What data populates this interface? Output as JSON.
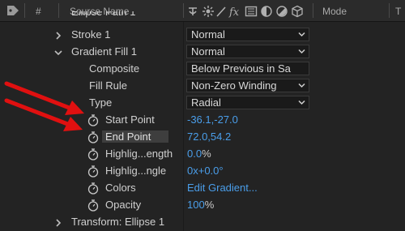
{
  "header": {
    "hash": "#",
    "source_name": "Source Name",
    "mode": "Mode",
    "t": "T"
  },
  "rows": {
    "ellipse_path": "Ellipse Path 1",
    "stroke": "Stroke 1",
    "stroke_value": "Normal",
    "gradient_fill": "Gradient Fill 1",
    "gradient_fill_value": "Normal",
    "composite": "Composite",
    "composite_value": "Below Previous in Sa",
    "fill_rule": "Fill Rule",
    "fill_rule_value": "Non-Zero Winding",
    "type": "Type",
    "type_value": "Radial",
    "start_point": "Start Point",
    "start_point_value": "-36.1,-27.0",
    "end_point": "End Point",
    "end_point_value": "72.0,54.2",
    "highlight_length": "Highlig...ength",
    "highlight_length_value": "0.0",
    "highlight_length_unit": "%",
    "highlight_angle": "Highlig...ngle",
    "highlight_angle_value": "0x+0.0°",
    "colors": "Colors",
    "colors_value": "Edit Gradient...",
    "opacity": "Opacity",
    "opacity_value": "100",
    "opacity_unit": "%",
    "transform": "Transform: Ellipse 1"
  },
  "colors": {
    "value_blue": "#4a9eea",
    "annotation_red": "#e01010"
  }
}
